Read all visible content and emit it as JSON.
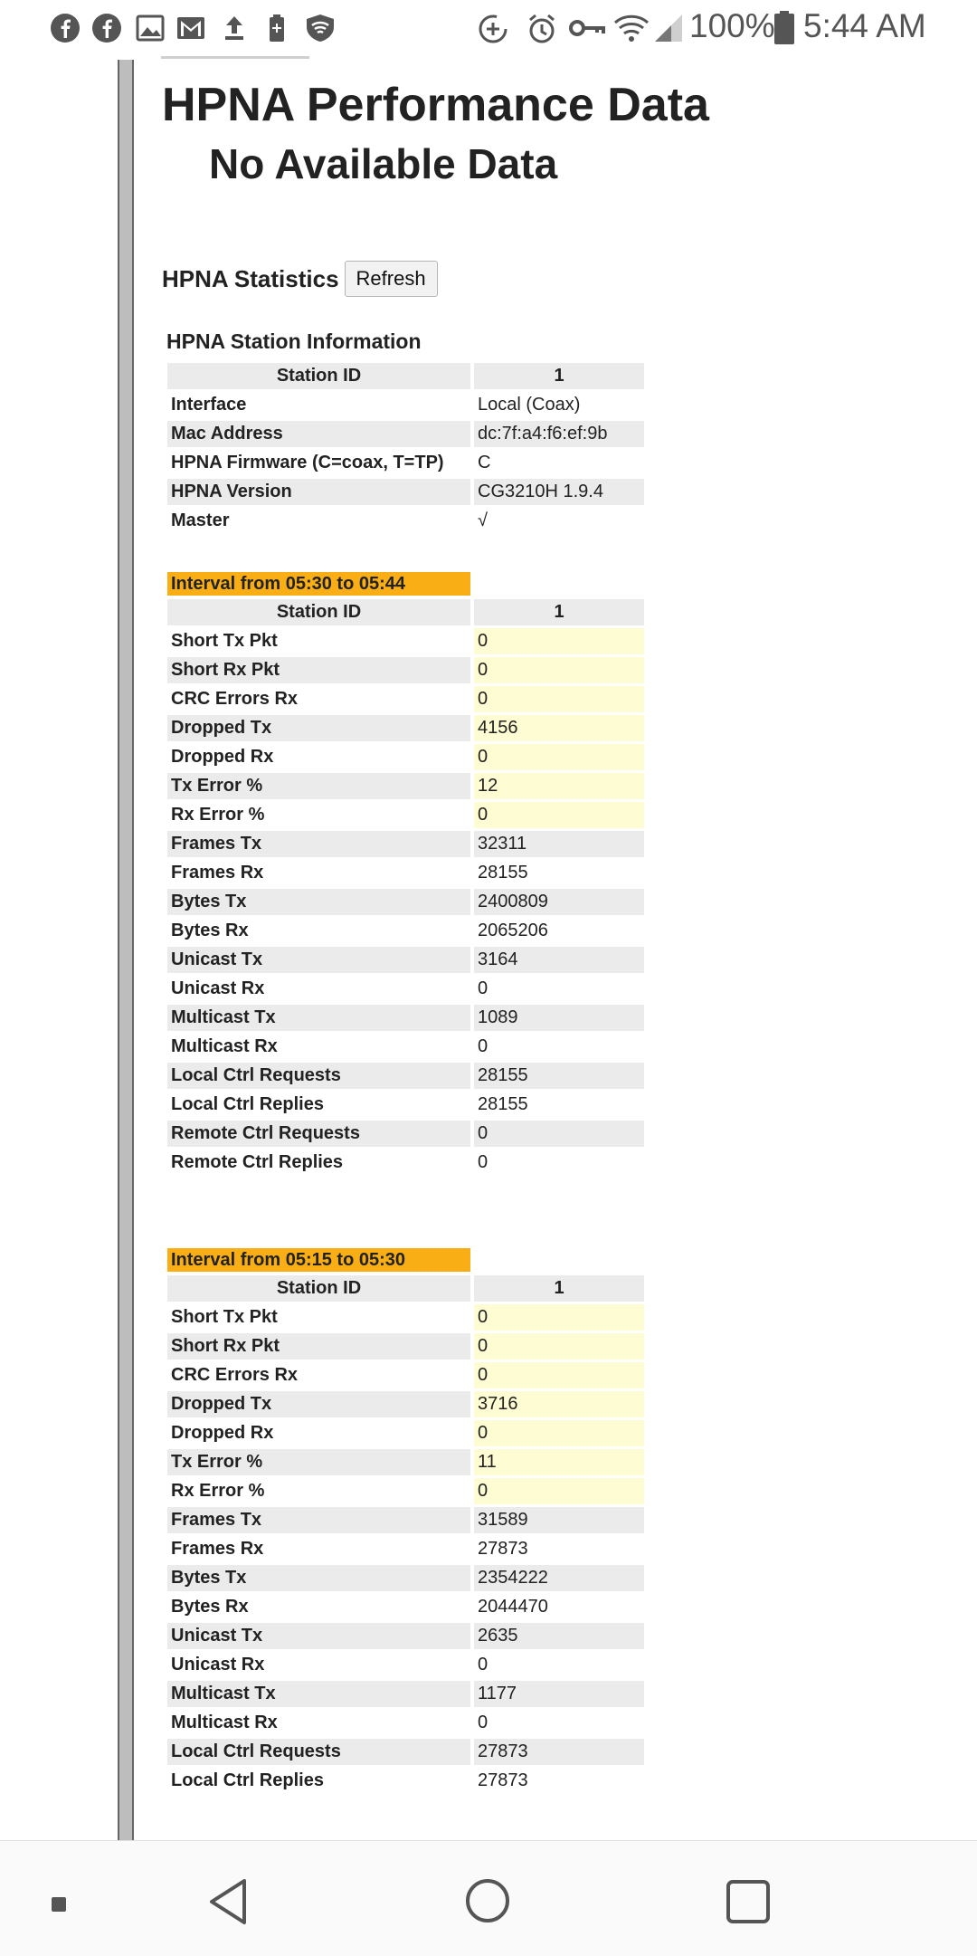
{
  "status_bar": {
    "left_icons": [
      "facebook-icon",
      "facebook-icon",
      "image-icon",
      "gmail-icon",
      "upload-icon",
      "battery-saver-icon",
      "shield-wifi-icon"
    ],
    "right_icons": [
      "data-saver-icon",
      "alarm-icon",
      "vpn-key-icon",
      "wifi-icon",
      "signal-icon",
      "battery-icon"
    ],
    "battery": "100%",
    "time": "5:44 AM"
  },
  "page": {
    "title": "HPNA Performance Data",
    "subtitle": "No Available Data",
    "stats_title": "HPNA Statistics",
    "refresh_label": "Refresh",
    "station_info_caption": "HPNA Station Information"
  },
  "station_info": {
    "header": [
      "Station ID",
      "1"
    ],
    "rows": [
      [
        "Interface",
        "Local (Coax)"
      ],
      [
        "Mac Address",
        "dc:7f:a4:f6:ef:9b"
      ],
      [
        "HPNA Firmware (C=coax, T=TP)",
        "C"
      ],
      [
        "HPNA Version",
        "CG3210H 1.9.4"
      ],
      [
        "Master",
        "√"
      ]
    ]
  },
  "intervals": [
    {
      "label": "Interval from 05:30 to 05:44",
      "header": [
        "Station ID",
        "1"
      ],
      "rows": [
        [
          "Short Tx Pkt",
          "0"
        ],
        [
          "Short Rx Pkt",
          "0"
        ],
        [
          "CRC Errors Rx",
          "0"
        ],
        [
          "Dropped Tx",
          "4156"
        ],
        [
          "Dropped Rx",
          "0"
        ],
        [
          "Tx Error %",
          "12"
        ],
        [
          "Rx Error %",
          "0"
        ],
        [
          "Frames Tx",
          "32311"
        ],
        [
          "Frames Rx",
          "28155"
        ],
        [
          "Bytes Tx",
          "2400809"
        ],
        [
          "Bytes Rx",
          "2065206"
        ],
        [
          "Unicast Tx",
          "3164"
        ],
        [
          "Unicast Rx",
          "0"
        ],
        [
          "Multicast Tx",
          "1089"
        ],
        [
          "Multicast Rx",
          "0"
        ],
        [
          "Local Ctrl Requests",
          "28155"
        ],
        [
          "Local Ctrl Replies",
          "28155"
        ],
        [
          "Remote Ctrl Requests",
          "0"
        ],
        [
          "Remote Ctrl Replies",
          "0"
        ]
      ]
    },
    {
      "label": "Interval from 05:15 to 05:30",
      "header": [
        "Station ID",
        "1"
      ],
      "rows": [
        [
          "Short Tx Pkt",
          "0"
        ],
        [
          "Short Rx Pkt",
          "0"
        ],
        [
          "CRC Errors Rx",
          "0"
        ],
        [
          "Dropped Tx",
          "3716"
        ],
        [
          "Dropped Rx",
          "0"
        ],
        [
          "Tx Error %",
          "11"
        ],
        [
          "Rx Error %",
          "0"
        ],
        [
          "Frames Tx",
          "31589"
        ],
        [
          "Frames Rx",
          "27873"
        ],
        [
          "Bytes Tx",
          "2354222"
        ],
        [
          "Bytes Rx",
          "2044470"
        ],
        [
          "Unicast Tx",
          "2635"
        ],
        [
          "Unicast Rx",
          "0"
        ],
        [
          "Multicast Tx",
          "1177"
        ],
        [
          "Multicast Rx",
          "0"
        ],
        [
          "Local Ctrl Requests",
          "27873"
        ],
        [
          "Local Ctrl Replies",
          "27873"
        ]
      ]
    }
  ],
  "colors": {
    "interval_header": "#f9ae16",
    "highlight_cell": "#fdfcd2",
    "shade_row": "#ebebeb"
  },
  "nav_bar": [
    "recents-dot-icon",
    "back-icon",
    "home-icon",
    "overview-icon"
  ]
}
